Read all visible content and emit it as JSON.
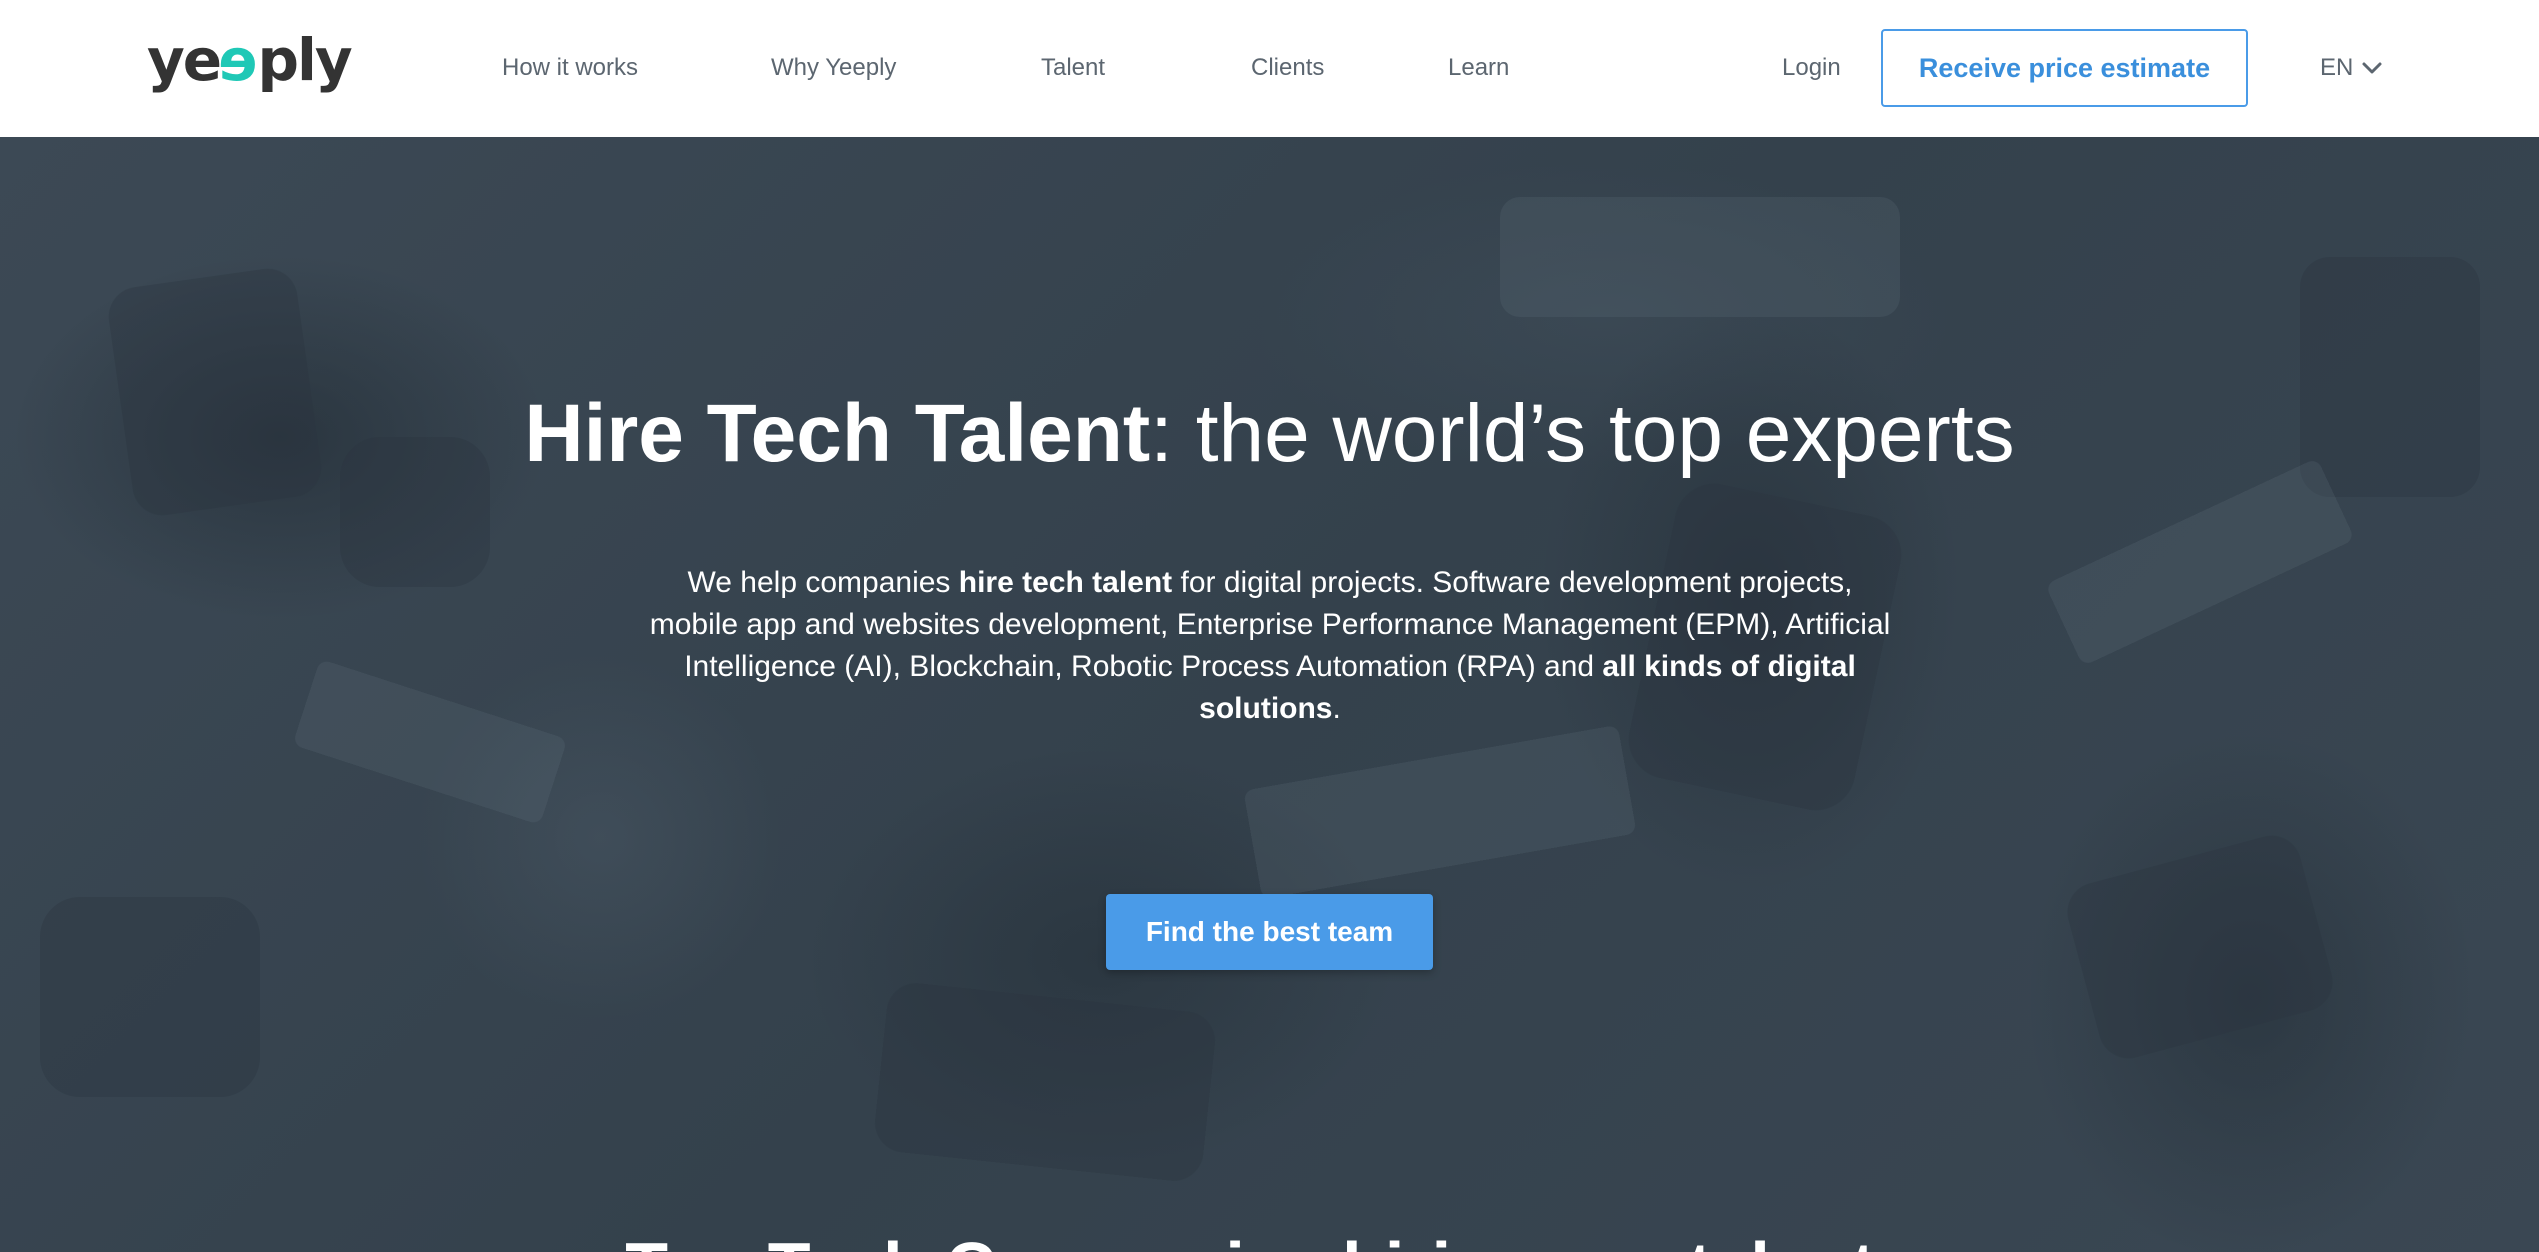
{
  "header": {
    "logo": {
      "part1": "ye",
      "part2": "e",
      "part3": "ply"
    },
    "nav": [
      {
        "label": "How it works"
      },
      {
        "label": "Why Yeeply"
      },
      {
        "label": "Talent"
      },
      {
        "label": "Clients"
      },
      {
        "label": "Learn"
      }
    ],
    "login_label": "Login",
    "estimate_label": "Receive price estimate",
    "language": "EN",
    "language_icon": "chevron-down-icon"
  },
  "hero": {
    "title_bold": "Hire Tech Talent",
    "title_rest": ": the world’s top experts",
    "desc": {
      "p1": "We help companies ",
      "b1": "hire tech talent",
      "p2": " for digital projects. Software development projects, mobile app and websites development, Enterprise Performance Management (EPM), Artificial Intelligence (AI), Blockchain, Robotic Process Automation (RPA) and ",
      "b2": "all kinds of digital solutions",
      "p3": "."
    },
    "cta_label": "Find the best team"
  },
  "next_section": {
    "title_bold": "Top Tech Companies",
    "title_rest": " hiring our talents"
  },
  "colors": {
    "accent": "#4a9be8",
    "logo_accent": "#1fc8b6",
    "hero_bg": "#3a4753",
    "nav_text": "#5c6670"
  }
}
